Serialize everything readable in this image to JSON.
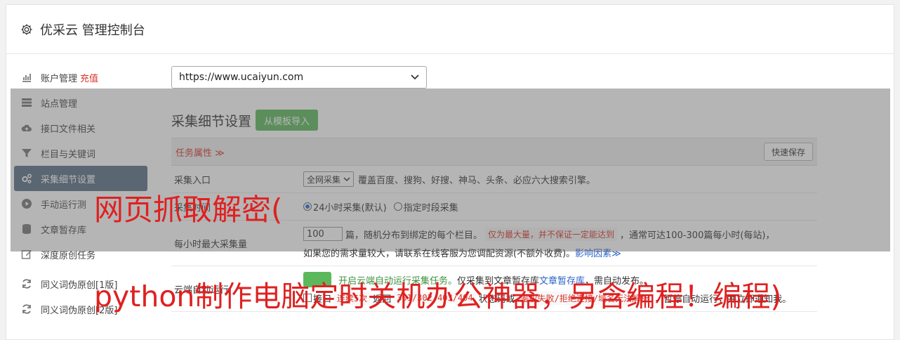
{
  "header": {
    "title": "优采云 管理控制台"
  },
  "sidebar": {
    "recharge": "充值",
    "items": [
      {
        "label": "账户管理"
      },
      {
        "label": "站点管理"
      },
      {
        "label": "接口文件相关"
      },
      {
        "label": "栏目与关键词"
      },
      {
        "label": "采集细节设置"
      },
      {
        "label": "手动运行测"
      },
      {
        "label": "文章暂存库"
      },
      {
        "label": "深度原创任务"
      },
      {
        "label": "同义词伪原创[1版]"
      },
      {
        "label": "同义词伪原创[2版]"
      }
    ]
  },
  "site": {
    "selected": "https://www.ucaiyun.com"
  },
  "section": {
    "title": "采集细节设置",
    "import_label": "从模板导入"
  },
  "props": {
    "title": "任务属性 ≫",
    "save_label": "快速保存"
  },
  "rows": {
    "entry": {
      "label": "采集入口",
      "select": "全网采集",
      "desc": "覆盖百度、搜狗、好搜、神马、头条、必应六大搜索引擎。"
    },
    "period": {
      "label": "采集时间",
      "opt1": "24小时采集(默认)",
      "opt2": "指定时段采集"
    },
    "max": {
      "label": "每小时最大采集量",
      "value": "100",
      "text1": "篇，随机分布到绑定的每个栏目。",
      "note": "仅为最大量，并不保证一定能达到",
      "text2": "，通常可达100-300篇每小时(每站)，",
      "text3": "如果您的需求量较大，请联系在线客服为您调配资源(不额外收费)。",
      "link": "影响因素≫"
    },
    "cloud": {
      "label": "云端自动运行",
      "text1": "开启云端自动运行采集任务。",
      "text2": "仅采集到文章暂存库",
      "link": "文章暂存库",
      "text3": "，需自动发布。",
      "chk_label": "接口",
      "code1": "连续5次",
      "text4": "返回",
      "code2": "301/302/403/404",
      "text5": "状态码或",
      "code3": "鉴权失败/拒绝连接/域名无法解析",
      "text6": "，暂停自动运行，并立即通知我。"
    }
  },
  "banners": {
    "line1": "网页抓取解密(",
    "line2": "python制作电脑定时关机办公神器，另含编程！编程)"
  }
}
